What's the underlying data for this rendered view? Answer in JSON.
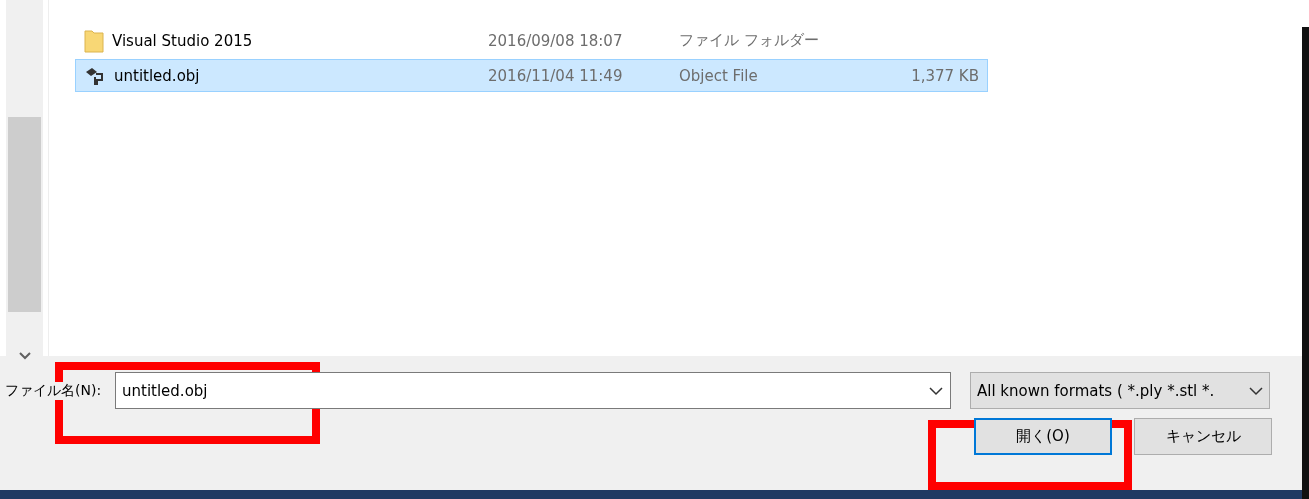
{
  "files": [
    {
      "kind": "folder",
      "name": "Visual Studio 2015",
      "date": "2016/09/08 18:07",
      "type": "ファイル フォルダー",
      "selected": false
    },
    {
      "kind": "object",
      "name": "untitled.obj",
      "date": "2016/11/04 11:49",
      "type": "Object File",
      "size": "1,377 KB",
      "selected": true
    }
  ],
  "file_name": {
    "label": "ファイル名(N):",
    "value": "untitled.obj"
  },
  "file_type": {
    "value": "All known formats ( *.ply *.stl *."
  },
  "buttons": [
    {
      "label": "開く(O)",
      "focused": true
    },
    {
      "label": "キャンセル",
      "focused": false
    }
  ]
}
